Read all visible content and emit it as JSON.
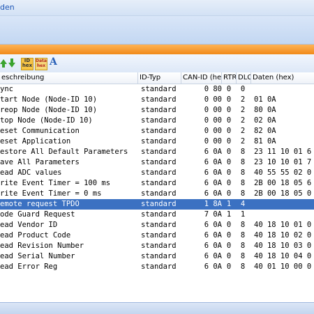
{
  "menubar": {
    "item": "den"
  },
  "toolbar": {
    "icons": [
      "arrow-up-icon",
      "arrow-down-icon",
      "id-hex-icon",
      "data-hex-icon",
      "font-icon"
    ],
    "id_hex_top": "ID",
    "id_hex_bottom": "hex",
    "data_hex_top": "Data",
    "data_hex_bottom": "hex",
    "font_letter": "A"
  },
  "colors": {
    "accent": "#f08a1a",
    "selection": "#3b71c2",
    "ribbon": "#c3d7f2"
  },
  "table": {
    "columns": [
      "eschreibung",
      "ID-Typ",
      "CAN-ID (hex)",
      "RTR",
      "DLC",
      "Daten (hex)"
    ],
    "selected_index": 11,
    "rows": [
      {
        "desc": "ync",
        "type": "standard",
        "id": "0 80",
        "rtr": "0",
        "dlc": "0",
        "data": ""
      },
      {
        "desc": "tart Node (Node-ID 10)",
        "type": "standard",
        "id": "0 00",
        "rtr": "0",
        "dlc": "2",
        "data": "01 0A"
      },
      {
        "desc": "reop Node (Node-ID 10)",
        "type": "standard",
        "id": "0 00",
        "rtr": "0",
        "dlc": "2",
        "data": "80 0A"
      },
      {
        "desc": "top Node (Node-ID 10)",
        "type": "standard",
        "id": "0 00",
        "rtr": "0",
        "dlc": "2",
        "data": "02 0A"
      },
      {
        "desc": "eset Communication",
        "type": "standard",
        "id": "0 00",
        "rtr": "0",
        "dlc": "2",
        "data": "82 0A"
      },
      {
        "desc": "eset Application",
        "type": "standard",
        "id": "0 00",
        "rtr": "0",
        "dlc": "2",
        "data": "81 0A"
      },
      {
        "desc": "estore All Default Parameters",
        "type": "standard",
        "id": "6 0A",
        "rtr": "0",
        "dlc": "8",
        "data": "23 11 10 01 6"
      },
      {
        "desc": "ave All Parameters",
        "type": "standard",
        "id": "6 0A",
        "rtr": "0",
        "dlc": "8",
        "data": "23 10 10 01 7"
      },
      {
        "desc": "ead ADC values",
        "type": "standard",
        "id": "6 0A",
        "rtr": "0",
        "dlc": "8",
        "data": "40 55 55 02 0"
      },
      {
        "desc": "rite Event Timer = 100 ms",
        "type": "standard",
        "id": "6 0A",
        "rtr": "0",
        "dlc": "8",
        "data": "2B 00 18 05 6"
      },
      {
        "desc": "rite Event Timer = 0 ms",
        "type": "standard",
        "id": "6 0A",
        "rtr": "0",
        "dlc": "8",
        "data": "2B 00 18 05 0"
      },
      {
        "desc": "emote request TPDO",
        "type": "standard",
        "id": "1 8A",
        "rtr": "1",
        "dlc": "4",
        "data": ""
      },
      {
        "desc": "ode Guard Request",
        "type": "standard",
        "id": "7 0A",
        "rtr": "1",
        "dlc": "1",
        "data": ""
      },
      {
        "desc": "ead Vendor ID",
        "type": "standard",
        "id": "6 0A",
        "rtr": "0",
        "dlc": "8",
        "data": "40 18 10 01 0"
      },
      {
        "desc": "ead Product Code",
        "type": "standard",
        "id": "6 0A",
        "rtr": "0",
        "dlc": "8",
        "data": "40 18 10 02 0"
      },
      {
        "desc": "ead Revision Number",
        "type": "standard",
        "id": "6 0A",
        "rtr": "0",
        "dlc": "8",
        "data": "40 18 10 03 0"
      },
      {
        "desc": "ead Serial Number",
        "type": "standard",
        "id": "6 0A",
        "rtr": "0",
        "dlc": "8",
        "data": "40 18 10 04 0"
      },
      {
        "desc": "ead Error Reg",
        "type": "standard",
        "id": "6 0A",
        "rtr": "0",
        "dlc": "8",
        "data": "40 01 10 00 0"
      }
    ]
  }
}
